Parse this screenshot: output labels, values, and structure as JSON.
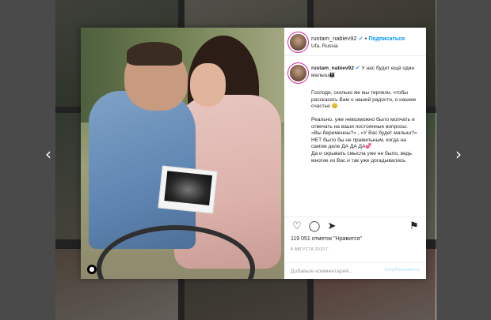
{
  "post": {
    "username": "rustam_nabiev92",
    "verified_mark": "✔",
    "separator": "•",
    "follow_label": "Подписаться",
    "location": "Ufa, Russia"
  },
  "caption": {
    "username": "rustam_nabiev92",
    "verified_mark": "✔",
    "headline": "У нас будет ещё один малыш👨‍👩‍👦",
    "paragraph1": "Господи, сколько же мы терпели, чтобы рассказать Вам о нашей радости, о нашем счастье 😊",
    "paragraph2_lines": [
      "Реально, уже невозможно было молчать и отвечать на ваши постоянные вопросы:",
      "«Вы беременны?» , «У Вас будет малыш?» НЕТ было бы не правильным, когда на самом деле ДА ДА ДА💞",
      "Да и скрывать смысла уже не было, ведь многие из Вас и так уже догадывались."
    ]
  },
  "actions": {
    "like_icon": "♡",
    "comment_icon": "◯",
    "share_icon": "➤",
    "save_icon": "⚑",
    "likes_text": "119 051 отметок \"Нравится\"",
    "date_text": "8 АВГУСТА 2019 Г."
  },
  "comment": {
    "placeholder": "Добавьте комментарий...",
    "post_label": "Опубликовать"
  },
  "nav": {
    "prev_icon": "‹",
    "next_icon": "›"
  },
  "photo": {
    "user_tag_icon": "●"
  },
  "colors": {
    "accent": "#0095f6",
    "verified": "#3897f0",
    "backdrop": "#4a4a4a"
  }
}
